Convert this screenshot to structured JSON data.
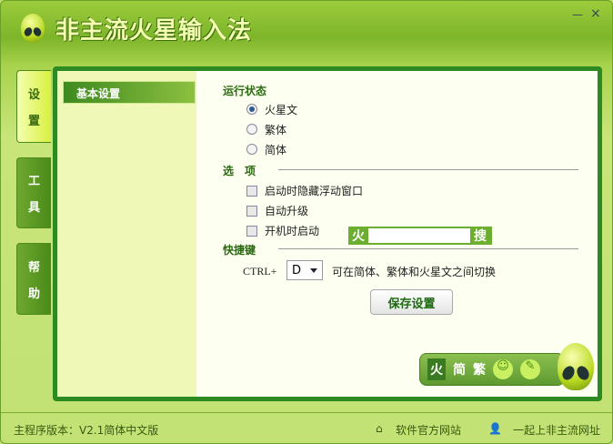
{
  "app": {
    "title": "非主流火星输入法",
    "minimize": "—",
    "close": "×"
  },
  "tabs": [
    {
      "label": [
        "设",
        "置"
      ],
      "selected": true
    },
    {
      "label": [
        "工",
        "具"
      ]
    },
    {
      "label": [
        "帮",
        "助"
      ]
    }
  ],
  "sidebar": {
    "items": [
      {
        "label": "基本设置",
        "selected": true
      }
    ]
  },
  "run_state": {
    "heading": "运行状态",
    "options": [
      {
        "label": "火星文",
        "checked": true
      },
      {
        "label": "繁体",
        "checked": false
      },
      {
        "label": "简体",
        "checked": false
      }
    ]
  },
  "options": {
    "heading": "选　项",
    "items": [
      {
        "label": "启动时隐藏浮动窗口",
        "checked": false
      },
      {
        "label": "自动升级",
        "checked": false
      },
      {
        "label": "开机时启动",
        "checked": false
      }
    ]
  },
  "search": {
    "left": "火",
    "right": "搜",
    "value": ""
  },
  "hotkey": {
    "heading": "快捷键",
    "prefix": "CTRL+",
    "key": "D",
    "description": "可在简体、繁体和火星文之间切换"
  },
  "save_label": "保存设置",
  "floatbar": {
    "fire": "火",
    "simplified": "简",
    "traditional": "繁"
  },
  "footer": {
    "version": "主程序版本：V2.1简体中文版",
    "site": "软件官方网站",
    "community": "一起上非主流网址"
  },
  "colors": {
    "accent": "#2d8a20",
    "panel": "#fdfff0"
  }
}
